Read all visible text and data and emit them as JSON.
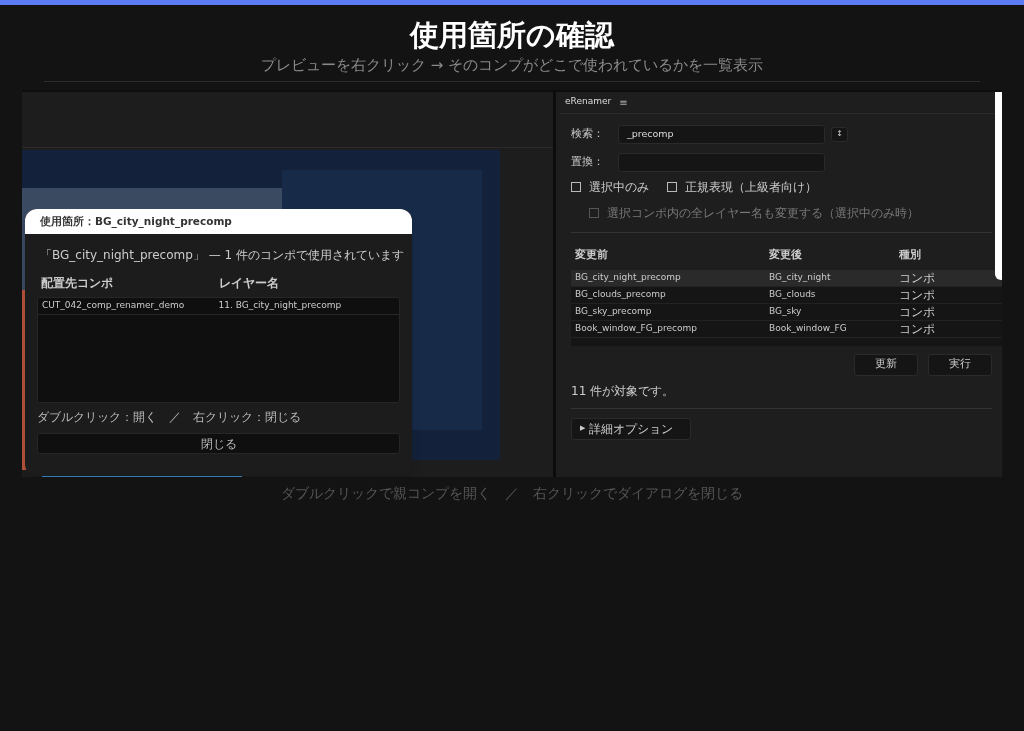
{
  "header": {
    "title": "使用箇所の確認",
    "subtitle": "プレビューを右クリック → そのコンプがどこで使われているかを一覧表示"
  },
  "dialog": {
    "title": "使用箇所：BG_city_night_precomp",
    "summary": "「BG_city_night_precomp」 — 1 件のコンポで使用されています",
    "columns": [
      "配置先コンポ",
      "レイヤー名"
    ],
    "rows": [
      {
        "cells": [
          "CUT_042_comp_renamer_demo",
          "11. BG_city_night_precomp"
        ]
      }
    ],
    "hint": "ダブルクリック：開く　／　右クリック：閉じる",
    "close_button": "閉じる"
  },
  "panel": {
    "title": "eRenamer",
    "menu_icon": "≡",
    "fields": [
      {
        "label": "検索：",
        "value": "_precomp",
        "swap": "↕"
      },
      {
        "label": "置換："
      }
    ],
    "options": [
      {
        "label": "選択中のみ",
        "checked": false,
        "disabled": false
      },
      {
        "label": "正規表現（上級者向け）",
        "checked": false,
        "disabled": false
      }
    ],
    "sub_option": {
      "label": "選択コンポ内の全レイヤー名も変更する（選択中のみ時）",
      "checked": false,
      "disabled": true
    },
    "columns": [
      "変更前",
      "変更後",
      "種別"
    ],
    "rows": [
      {
        "cells": [
          "BG_city_night_precomp",
          "BG_city_night",
          "コンポ"
        ],
        "selected": true
      },
      {
        "cells": [
          "BG_clouds_precomp",
          "BG_clouds",
          "コンポ"
        ],
        "selected": false
      },
      {
        "cells": [
          "BG_sky_precomp",
          "BG_sky",
          "コンポ"
        ],
        "selected": false
      },
      {
        "cells": [
          "Book_window_FG_precomp",
          "Book_window_FG",
          "コンポ"
        ],
        "selected": false
      }
    ],
    "buttons": [
      "更新",
      "実行"
    ],
    "status": "11 件が対象です。",
    "advanced": {
      "arrow": "▶",
      "label": "詳細オプション"
    }
  },
  "caption": "ダブルクリックで親コンプを開く　／　右クリックでダイアログを閉じる"
}
